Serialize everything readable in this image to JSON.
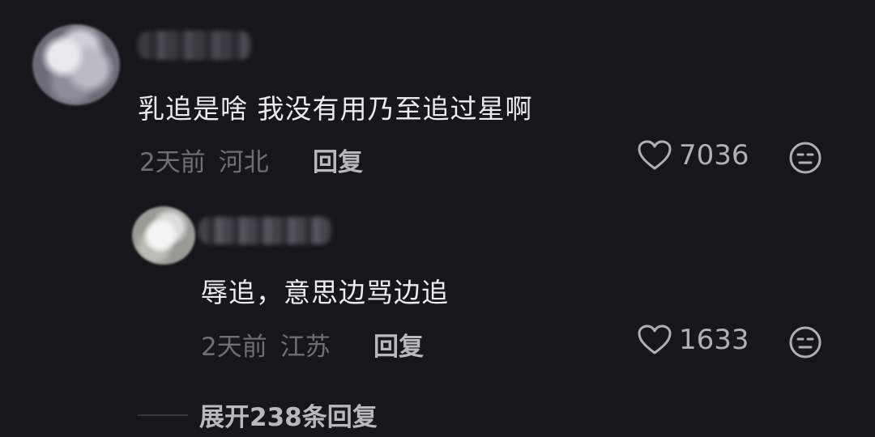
{
  "comments": [
    {
      "text": "乳追是啥 我没有用乃至追过星啊",
      "time": "2天前",
      "region": "河北",
      "reply_label": "回复",
      "likes": "7036"
    }
  ],
  "replies": [
    {
      "text": "辱追，意思边骂边追",
      "time": "2天前",
      "region": "江苏",
      "reply_label": "回复",
      "likes": "1633"
    }
  ],
  "expand": {
    "label": "展开238条回复"
  },
  "icons": {
    "like": "heart-outline-icon",
    "dislike": "neutral-face-icon"
  },
  "colors": {
    "background": "#17161b",
    "text_primary": "#ececee",
    "text_muted": "#6f6e77"
  }
}
